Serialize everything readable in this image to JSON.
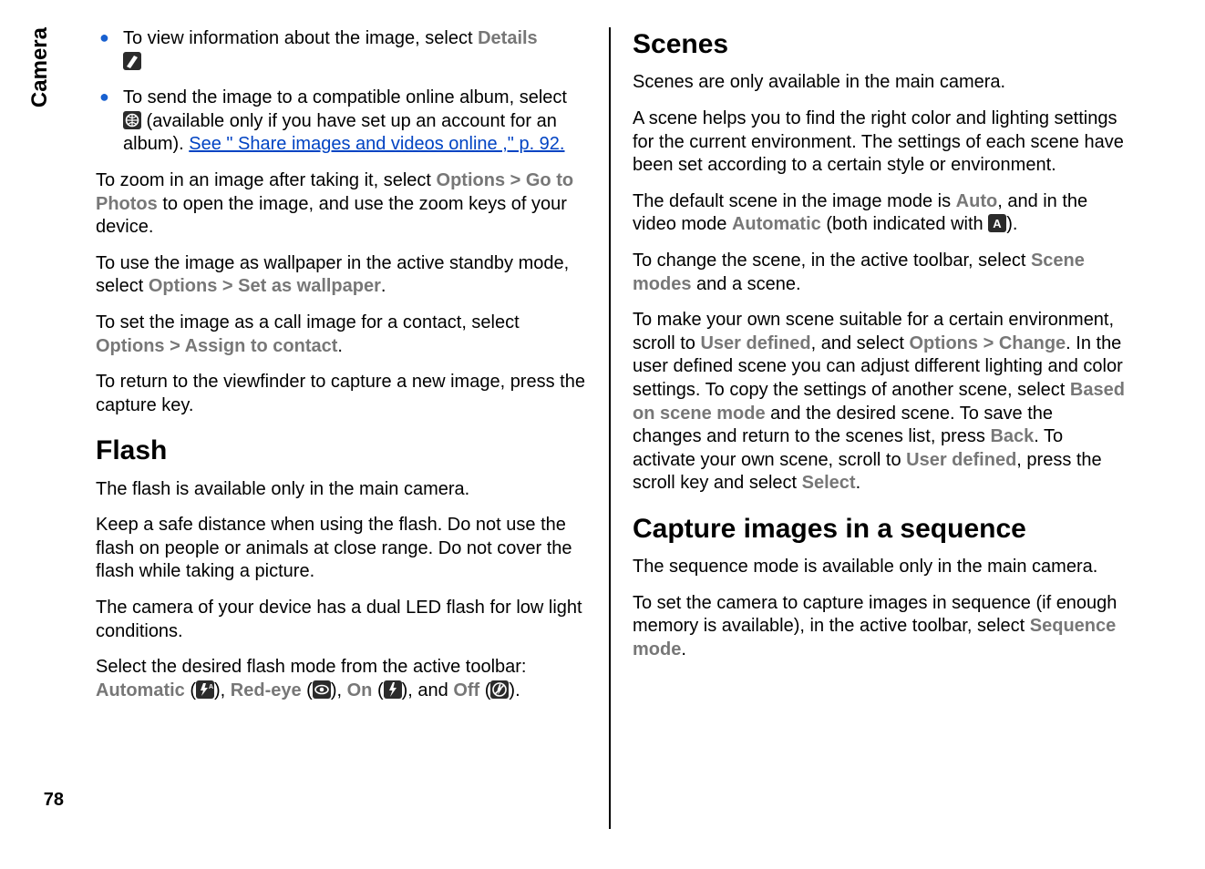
{
  "sideTab": "Camera",
  "pageNumber": "78",
  "left": {
    "bullets": [
      {
        "pre": "To view information about the image, select ",
        "bold": "Details"
      },
      {
        "pre": "To send the image to a compatible online album, select ",
        "mid": " (available only if you have set up an account for an album). ",
        "link": "See \" Share images and videos online ,\" p. 92."
      }
    ],
    "p1a": "To zoom in an image after taking it, select ",
    "p1b": "Options",
    "p1c": "Go to Photos",
    "p1d": " to open the image, and use the zoom keys of your device.",
    "p2a": "To use the image as wallpaper in the active standby mode, select ",
    "p2b": "Options",
    "p2c": "Set as wallpaper",
    "p3a": "To set the image as a call image for a contact, select ",
    "p3b": "Options",
    "p3c": "Assign to contact",
    "p4": "To return to the viewfinder to capture a new image, press the capture key.",
    "h2Flash": "Flash",
    "f1": "The flash is available only in the main camera.",
    "f2": "Keep a safe distance when using the flash. Do not use the flash on people or animals at close range. Do not cover the flash while taking a picture.",
    "f3": "The camera of your device has a dual LED flash for low light conditions.",
    "f4a": "Select the desired flash mode from the active toolbar: ",
    "f4auto": "Automatic",
    "f4red": "Red-eye",
    "f4on": "On",
    "f4off": "Off"
  },
  "right": {
    "h2Scenes": "Scenes",
    "s1": "Scenes are only available in the main camera.",
    "s2": "A scene helps you to find the right color and lighting settings for the current environment. The settings of each scene have been set according to a certain style or environment.",
    "s3a": "The default scene in the image mode is ",
    "s3b": "Auto",
    "s3c": ", and in the video mode ",
    "s3d": "Automatic",
    "s3e": " (both indicated with ",
    "s3f": ").",
    "s4a": "To change the scene, in the active toolbar, select ",
    "s4b": "Scene modes",
    "s4c": " and a scene.",
    "s5a": "To make your own scene suitable for a certain environment, scroll to ",
    "s5b": "User defined",
    "s5c": ", and select ",
    "s5d": "Options",
    "s5e": "Change",
    "s5f": ". In the user defined scene you can adjust different lighting and color settings. To copy the settings of another scene, select ",
    "s5g": "Based on scene mode",
    "s5h": " and the desired scene. To save the changes and return to the scenes list, press ",
    "s5i": "Back",
    "s5j": ". To activate your own scene, scroll to ",
    "s5k": "User defined",
    "s5l": ", press the scroll key and select ",
    "s5m": "Select",
    "s5n": ".",
    "h2Seq": "Capture images in a sequence",
    "q1": "The sequence mode is available only in the main camera.",
    "q2a": "To set the camera to capture images in sequence (if enough memory is available), in the active toolbar, select ",
    "q2b": "Sequence mode",
    "q2c": "."
  },
  "gt": " > "
}
